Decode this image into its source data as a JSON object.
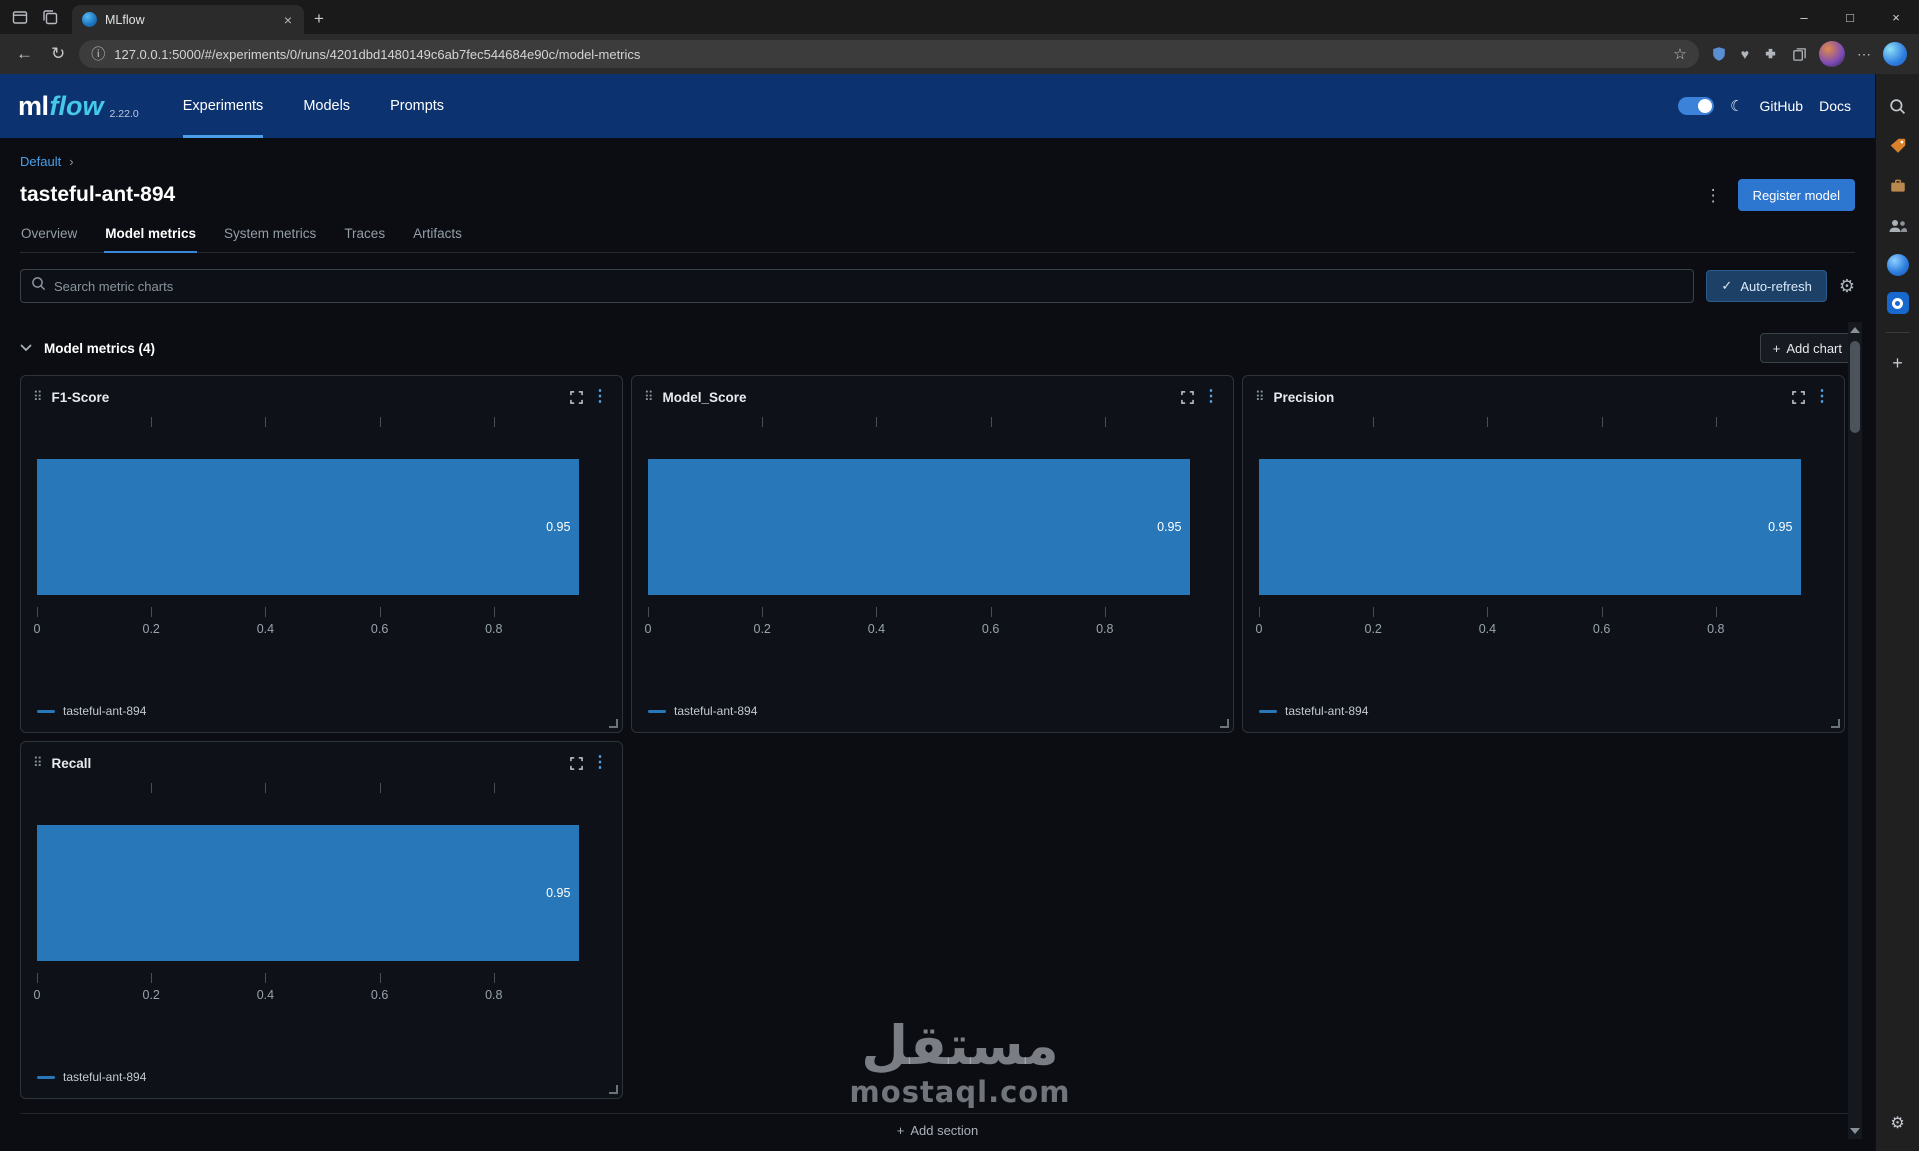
{
  "browser": {
    "tab_title": "MLflow",
    "url": "127.0.0.1:5000/#/experiments/0/runs/4201dbd1480149c6ab7fec544684e90c/model-metrics"
  },
  "icons": {
    "back": "←",
    "refresh": "↻",
    "info": "ⓘ",
    "star": "☆",
    "check": "✓",
    "gear": "⚙",
    "moon": "☾",
    "kebab": "⋮",
    "drag": "⠿",
    "close": "×",
    "minimize": "–",
    "maximize": "□",
    "plus": "+",
    "ellipsis": "⋯"
  },
  "header": {
    "logo_ml": "ml",
    "logo_flow": "flow",
    "version": "2.22.0",
    "nav": [
      {
        "label": "Experiments",
        "active": true
      },
      {
        "label": "Models",
        "active": false
      },
      {
        "label": "Prompts",
        "active": false
      }
    ],
    "github": "GitHub",
    "docs": "Docs"
  },
  "run_page": {
    "breadcrumb": "Default",
    "breadcrumb_sep": "›",
    "title": "tasteful-ant-894",
    "register_button": "Register model",
    "tabs": [
      {
        "label": "Overview",
        "active": false
      },
      {
        "label": "Model metrics",
        "active": true
      },
      {
        "label": "System metrics",
        "active": false
      },
      {
        "label": "Traces",
        "active": false
      },
      {
        "label": "Artifacts",
        "active": false
      }
    ],
    "search_placeholder": "Search metric charts",
    "auto_refresh_label": "Auto-refresh",
    "section_title": "Model metrics (4)",
    "add_chart_label": "Add chart",
    "add_section_label": "Add section"
  },
  "chart_data": [
    {
      "type": "bar",
      "orientation": "horizontal",
      "title": "F1-Score",
      "series": [
        {
          "name": "tasteful-ant-894",
          "values": [
            0.95
          ]
        }
      ],
      "value_label": "0.95",
      "x_ticks": [
        "0",
        "0.2",
        "0.4",
        "0.6",
        "0.8"
      ],
      "xlim": [
        0,
        1
      ],
      "bar_color": "#2878b9",
      "legend": "tasteful-ant-894"
    },
    {
      "type": "bar",
      "orientation": "horizontal",
      "title": "Model_Score",
      "series": [
        {
          "name": "tasteful-ant-894",
          "values": [
            0.95
          ]
        }
      ],
      "value_label": "0.95",
      "x_ticks": [
        "0",
        "0.2",
        "0.4",
        "0.6",
        "0.8"
      ],
      "xlim": [
        0,
        1
      ],
      "bar_color": "#2878b9",
      "legend": "tasteful-ant-894"
    },
    {
      "type": "bar",
      "orientation": "horizontal",
      "title": "Precision",
      "series": [
        {
          "name": "tasteful-ant-894",
          "values": [
            0.95
          ]
        }
      ],
      "value_label": "0.95",
      "x_ticks": [
        "0",
        "0.2",
        "0.4",
        "0.6",
        "0.8"
      ],
      "xlim": [
        0,
        1
      ],
      "bar_color": "#2878b9",
      "legend": "tasteful-ant-894"
    },
    {
      "type": "bar",
      "orientation": "horizontal",
      "title": "Recall",
      "series": [
        {
          "name": "tasteful-ant-894",
          "values": [
            0.95
          ]
        }
      ],
      "value_label": "0.95",
      "x_ticks": [
        "0",
        "0.2",
        "0.4",
        "0.6",
        "0.8"
      ],
      "xlim": [
        0,
        1
      ],
      "bar_color": "#2878b9",
      "legend": "tasteful-ant-894"
    }
  ],
  "watermark": {
    "arabic": "مستقل",
    "latin": "mostaql.com"
  },
  "colors": {
    "accent_button": "#2e77d0",
    "bar_blue": "#2878b9",
    "link_blue": "#4a9fe8",
    "header_navy": "#0d3270"
  }
}
